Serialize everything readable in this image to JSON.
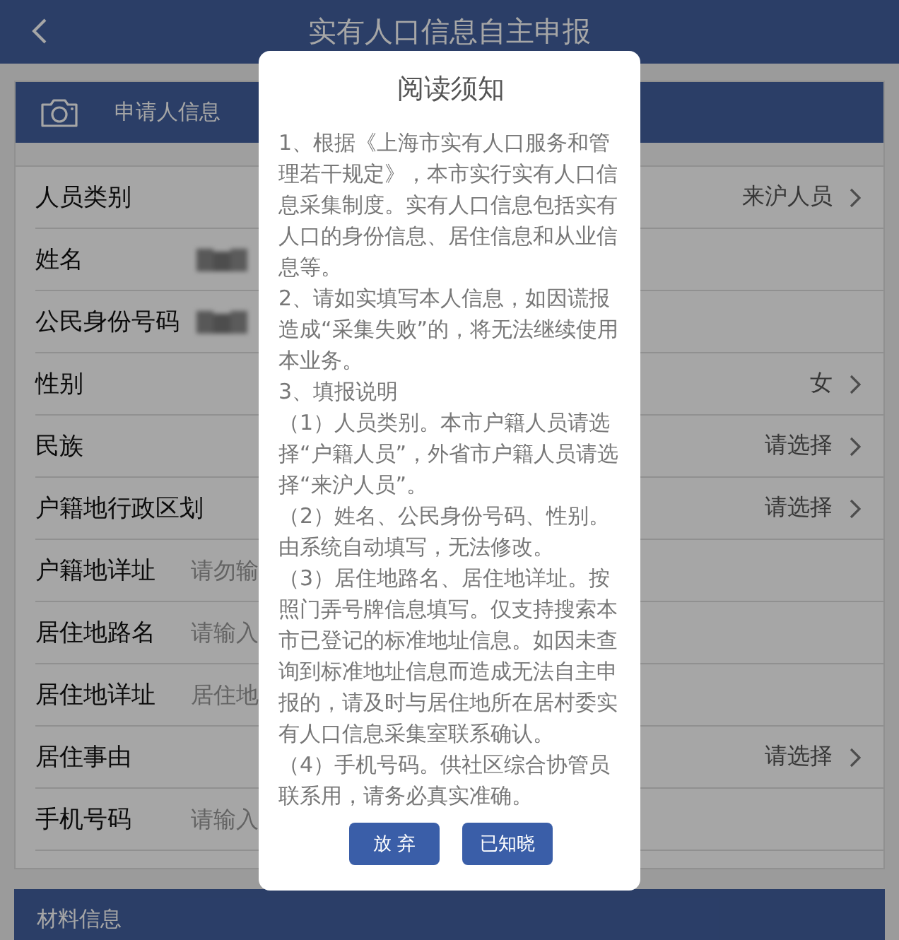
{
  "header": {
    "title": "实有人口信息自主申报"
  },
  "applicant_section": {
    "title": "申请人信息",
    "rows": [
      {
        "label": "人员类别",
        "kind": "select",
        "value": "来沪人员"
      },
      {
        "label": "姓名",
        "kind": "redacted"
      },
      {
        "label": "公民身份号码",
        "kind": "redacted"
      },
      {
        "label": "性别",
        "kind": "select",
        "value": "女"
      },
      {
        "label": "民族",
        "kind": "select",
        "value": "请选择"
      },
      {
        "label": "户籍地行政区划",
        "kind": "select",
        "value": "请选择"
      },
      {
        "label": "户籍地详址",
        "kind": "input",
        "placeholder": "请勿输"
      },
      {
        "label": "居住地路名",
        "kind": "input",
        "placeholder": "请输入"
      },
      {
        "label": "居住地详址",
        "kind": "input",
        "placeholder": "居住地"
      },
      {
        "label": "居住事由",
        "kind": "select",
        "value": "请选择"
      },
      {
        "label": "手机号码",
        "kind": "input",
        "placeholder": "请输入"
      }
    ]
  },
  "materials_section": {
    "title": "材料信息"
  },
  "dialog": {
    "title": "阅读须知",
    "paragraphs": [
      "1、根据《上海市实有人口服务和管理若干规定》，本市实行实有人口信息采集制度。实有人口信息包括实有人口的身份信息、居住信息和从业信息等。",
      "2、请如实填写本人信息，如因谎报造成“采集失败”的，将无法继续使用本业务。",
      "3、填报说明",
      "（1）人员类别。本市户籍人员请选择“户籍人员”，外省市户籍人员请选择“来沪人员”。",
      "（2）姓名、公民身份号码、性别。由系统自动填写，无法修改。",
      "（3）居住地路名、居住地详址。按照门弄号牌信息填写。仅支持搜索本市已登记的标准地址信息。如因未查询到标准地址信息而造成无法自主申报的，请及时与居住地所在居村委实有人口信息采集室联系确认。",
      "（4）手机号码。供社区综合协管员联系用，请务必真实准确。"
    ],
    "buttons": [
      "放 弃",
      "已知晓"
    ]
  }
}
